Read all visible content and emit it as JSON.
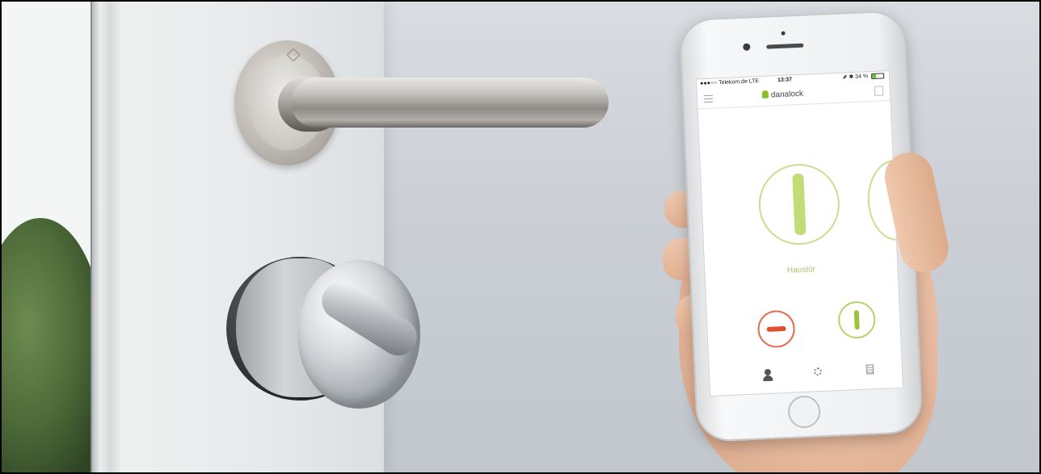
{
  "phone": {
    "status": {
      "carrier": "●●●○○ Telekom.de  LTE",
      "time": "13:37",
      "battery_text": "⬈ ✱ 34 %",
      "battery_level": 0.34
    },
    "app": {
      "brand": "danalock",
      "lock_name": "Haustür"
    },
    "icons": {
      "menu": "hamburger-menu-icon",
      "share": "share-icon",
      "users": "users-icon",
      "settings": "gear-icon",
      "log": "document-icon"
    },
    "colors": {
      "lock_red": "#e2512f",
      "unlock_green": "#9dc33b",
      "ring_green": "#c9df8e"
    }
  }
}
